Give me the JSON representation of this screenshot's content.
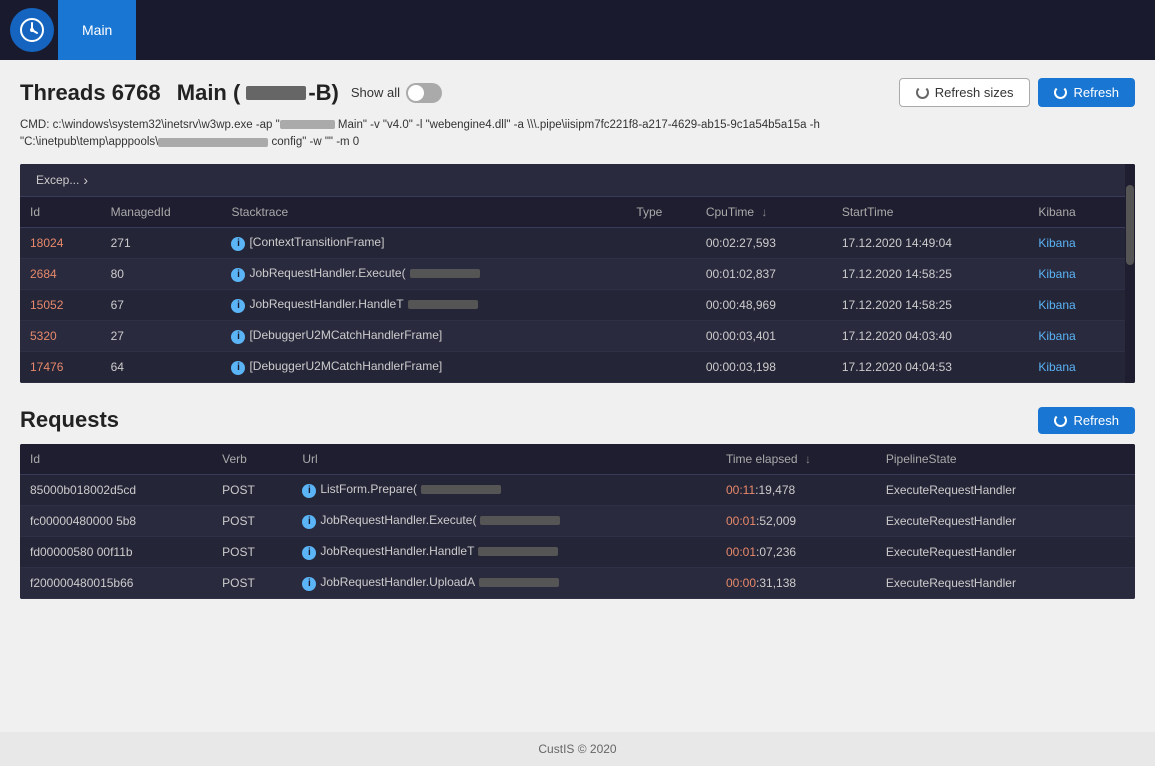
{
  "nav": {
    "tab_label": "Main"
  },
  "threads_section": {
    "title": "Threads 6768",
    "subtitle": "Main (",
    "subtitle2": "-B)",
    "show_all_label": "Show all",
    "refresh_sizes_label": "Refresh sizes",
    "refresh_label": "Refresh",
    "cmd_line": "CMD: c:\\windows\\system32\\inetsrv\\w3wp.exe -ap \"[redacted] Main\" -v \"v4.0\" -l \"webengine4.dll\" -a \\\\\\pipe\\iisipm7fc221f8-a217-4629-ab15-9c1a54b5a15a -h \"C:\\inetpub\\temp\\apppools\\[redacted] config\" -w \"\" -m 0",
    "table_toolbar_label": "Excep...",
    "columns": [
      {
        "key": "id",
        "label": "Id"
      },
      {
        "key": "managedId",
        "label": "ManagedId"
      },
      {
        "key": "stacktrace",
        "label": "Stacktrace"
      },
      {
        "key": "type",
        "label": "Type"
      },
      {
        "key": "cpuTime",
        "label": "CpuTime",
        "sortable": true,
        "sort_dir": "desc"
      },
      {
        "key": "startTime",
        "label": "StartTime"
      },
      {
        "key": "kibana",
        "label": "Kibana"
      }
    ],
    "rows": [
      {
        "id": "18024",
        "managedId": "271",
        "stacktrace": "[ContextTransitionFrame]",
        "stacktrace_redacted": false,
        "type": "",
        "cpuTime": "00:02:27,593",
        "startTime": "17.12.2020 14:49:04",
        "kibana": "Kibana"
      },
      {
        "id": "2684",
        "managedId": "80",
        "stacktrace": "JobRequestHandler.Execute(",
        "stacktrace_redacted": true,
        "type": "",
        "cpuTime": "00:01:02,837",
        "startTime": "17.12.2020 14:58:25",
        "kibana": "Kibana"
      },
      {
        "id": "15052",
        "managedId": "67",
        "stacktrace": "JobRequestHandler.HandleT",
        "stacktrace_redacted": true,
        "type": "",
        "cpuTime": "00:00:48,969",
        "startTime": "17.12.2020 14:58:25",
        "kibana": "Kibana"
      },
      {
        "id": "5320",
        "managedId": "27",
        "stacktrace": "[DebuggerU2MCatchHandlerFrame]",
        "stacktrace_redacted": false,
        "type": "",
        "cpuTime": "00:00:03,401",
        "startTime": "17.12.2020 04:03:40",
        "kibana": "Kibana"
      },
      {
        "id": "17476",
        "managedId": "64",
        "stacktrace": "[DebuggerU2MCatchHandlerFrame]",
        "stacktrace_redacted": false,
        "type": "",
        "cpuTime": "00:00:03,198",
        "startTime": "17.12.2020 04:04:53",
        "kibana": "Kibana"
      }
    ]
  },
  "requests_section": {
    "title": "Requests",
    "refresh_label": "Refresh",
    "columns": [
      {
        "key": "id",
        "label": "Id"
      },
      {
        "key": "verb",
        "label": "Verb"
      },
      {
        "key": "url",
        "label": "Url"
      },
      {
        "key": "timeElapsed",
        "label": "Time elapsed",
        "sortable": true,
        "sort_dir": "desc"
      },
      {
        "key": "pipelineState",
        "label": "PipelineState"
      }
    ],
    "rows": [
      {
        "id": "85000b018002d5cd",
        "verb": "POST",
        "url": "ListForm.Prepare(",
        "url_redacted": true,
        "timeElapsed": "00:11:19,478",
        "pipelineState": "ExecuteRequestHandler"
      },
      {
        "id": "fc00000480000 5b8",
        "verb": "POST",
        "url": "JobRequestHandler.Execute(",
        "url_redacted": true,
        "timeElapsed": "00:01:52,009",
        "pipelineState": "ExecuteRequestHandler"
      },
      {
        "id": "fd00000580 00f11b",
        "verb": "POST",
        "url": "JobRequestHandler.HandleT",
        "url_redacted": true,
        "timeElapsed": "00:01:07,236",
        "pipelineState": "ExecuteRequestHandler"
      },
      {
        "id": "f200000480015b66",
        "verb": "POST",
        "url": "JobRequestHandler.UploadA",
        "url_redacted": true,
        "timeElapsed": "00:00:31,138",
        "pipelineState": "ExecuteRequestHandler"
      }
    ]
  },
  "footer": {
    "text": "CustIS © 2020"
  },
  "icons": {
    "refresh": "↻",
    "info": "i",
    "chevron_right": "›"
  }
}
